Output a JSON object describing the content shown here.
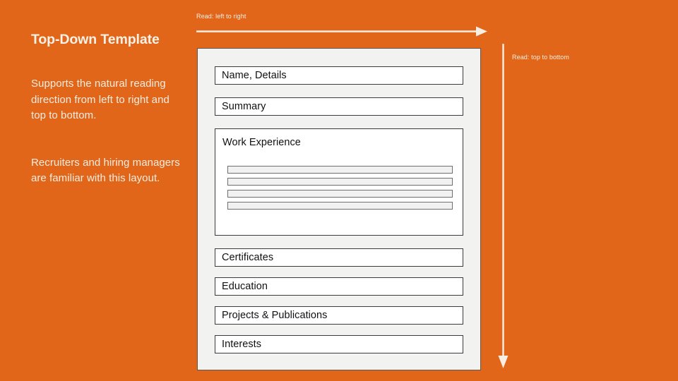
{
  "slide": {
    "title": "Top-Down Template",
    "paragraphs": [
      "Supports the natural reading direction from left to right and top to bottom.",
      "Recruiters and hiring managers are familiar with this layout."
    ],
    "background_color": "#E2661A",
    "text_color": "#F5EDE2"
  },
  "annotations": {
    "horizontal": {
      "label": "Read: left to right",
      "direction": "right"
    },
    "vertical": {
      "label": "Read: top to bottom",
      "direction": "down"
    },
    "arrow_color": "#F7EFE4"
  },
  "resume": {
    "page_color": "#F2F2F0",
    "border_color": "#5A5A58",
    "sections": [
      {
        "id": "name",
        "label": "Name, Details"
      },
      {
        "id": "summary",
        "label": "Summary"
      },
      {
        "id": "work",
        "label": "Work Experience"
      },
      {
        "id": "certificates",
        "label": "Certificates"
      },
      {
        "id": "education",
        "label": "Education"
      },
      {
        "id": "projects",
        "label": "Projects & Publications"
      },
      {
        "id": "interests",
        "label": "Interests"
      }
    ],
    "work_experience": {
      "title": "Work Experience",
      "entry_count": 4,
      "entries": [
        "",
        "",
        "",
        ""
      ]
    }
  }
}
